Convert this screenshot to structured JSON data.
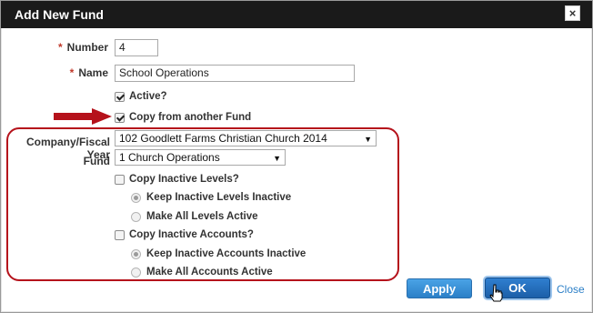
{
  "dialog": {
    "title": "Add New Fund",
    "close_icon": "×"
  },
  "form": {
    "number_label": "Number",
    "number_value": "4",
    "name_label": "Name",
    "name_value": "School Operations",
    "required_mark": "*",
    "active_label": "Active?",
    "active_checked": true,
    "copy_label": "Copy from another Fund",
    "copy_checked": true,
    "company_label": "Company/Fiscal Year",
    "company_value": "102 Goodlett Farms Christian Church 2014",
    "fund_label": "Fund",
    "fund_value": "1 Church Operations",
    "copy_inactive_levels_label": "Copy Inactive Levels?",
    "keep_levels_label": "Keep Inactive Levels Inactive",
    "make_levels_label": "Make All Levels Active",
    "copy_inactive_accounts_label": "Copy Inactive Accounts?",
    "keep_accounts_label": "Keep Inactive Accounts Inactive",
    "make_accounts_label": "Make All Accounts Active"
  },
  "buttons": {
    "apply": "Apply",
    "ok": "OK",
    "close": "Close"
  },
  "colors": {
    "annotation": "#b5121b",
    "accent": "#2b7fc7",
    "titlebar": "#1a1a1a"
  }
}
